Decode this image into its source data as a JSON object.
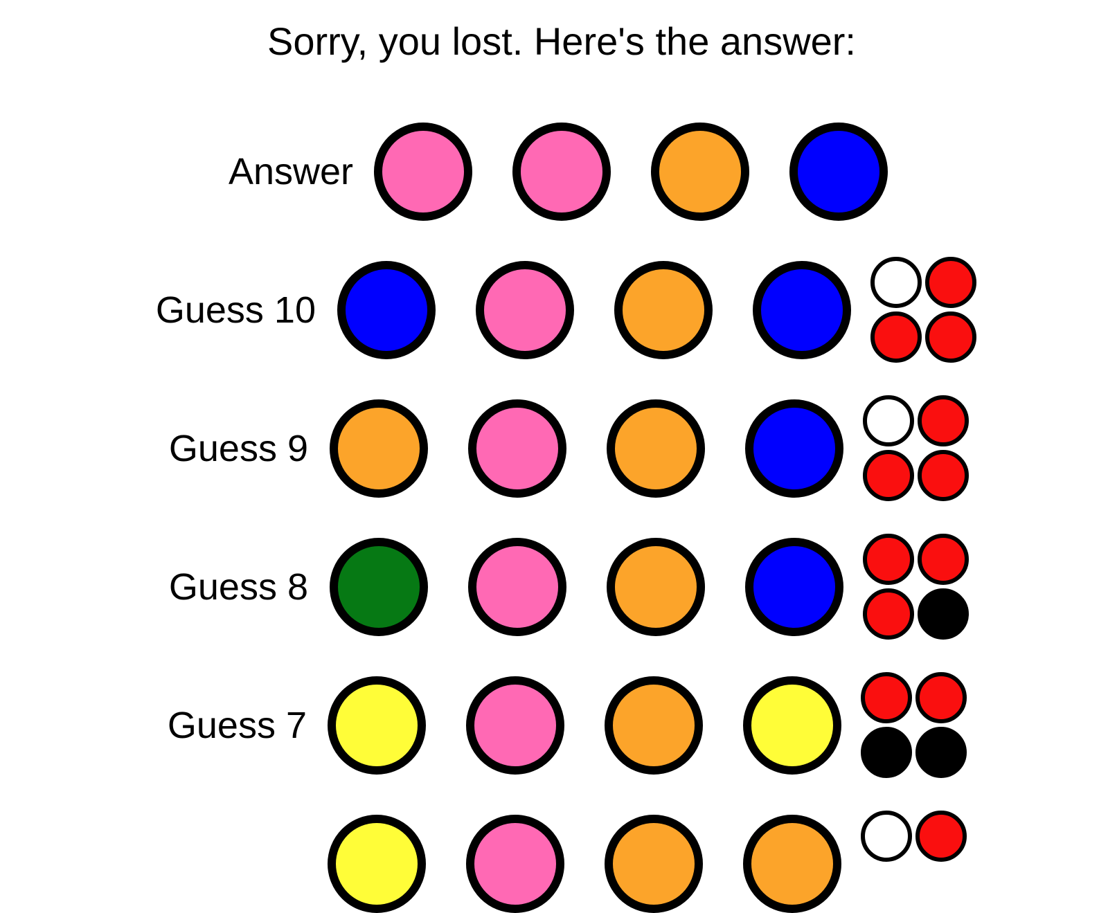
{
  "title": "Sorry, you lost. Here's the answer:",
  "colors": {
    "pink": "#ff69b4",
    "orange": "#fca42a",
    "blue": "#0000ff",
    "green": "#067914",
    "yellow": "#fffd38",
    "red": "#fa0f0f",
    "white": "#ffffff",
    "black": "#000000"
  },
  "rows": [
    {
      "label": "Answer",
      "pegs": [
        "pink",
        "pink",
        "orange",
        "blue"
      ],
      "feedback": []
    },
    {
      "label": "Guess 10",
      "pegs": [
        "blue",
        "pink",
        "orange",
        "blue"
      ],
      "feedback": [
        "white",
        "red",
        "red",
        "red"
      ]
    },
    {
      "label": "Guess 9",
      "pegs": [
        "orange",
        "pink",
        "orange",
        "blue"
      ],
      "feedback": [
        "white",
        "red",
        "red",
        "red"
      ]
    },
    {
      "label": "Guess 8",
      "pegs": [
        "green",
        "pink",
        "orange",
        "blue"
      ],
      "feedback": [
        "red",
        "red",
        "red",
        "black"
      ]
    },
    {
      "label": "Guess 7",
      "pegs": [
        "yellow",
        "pink",
        "orange",
        "yellow"
      ],
      "feedback": [
        "red",
        "red",
        "black",
        "black"
      ]
    },
    {
      "label": "",
      "pegs": [
        "yellow",
        "pink",
        "orange",
        "orange"
      ],
      "feedback": [
        "white",
        "red"
      ]
    }
  ]
}
